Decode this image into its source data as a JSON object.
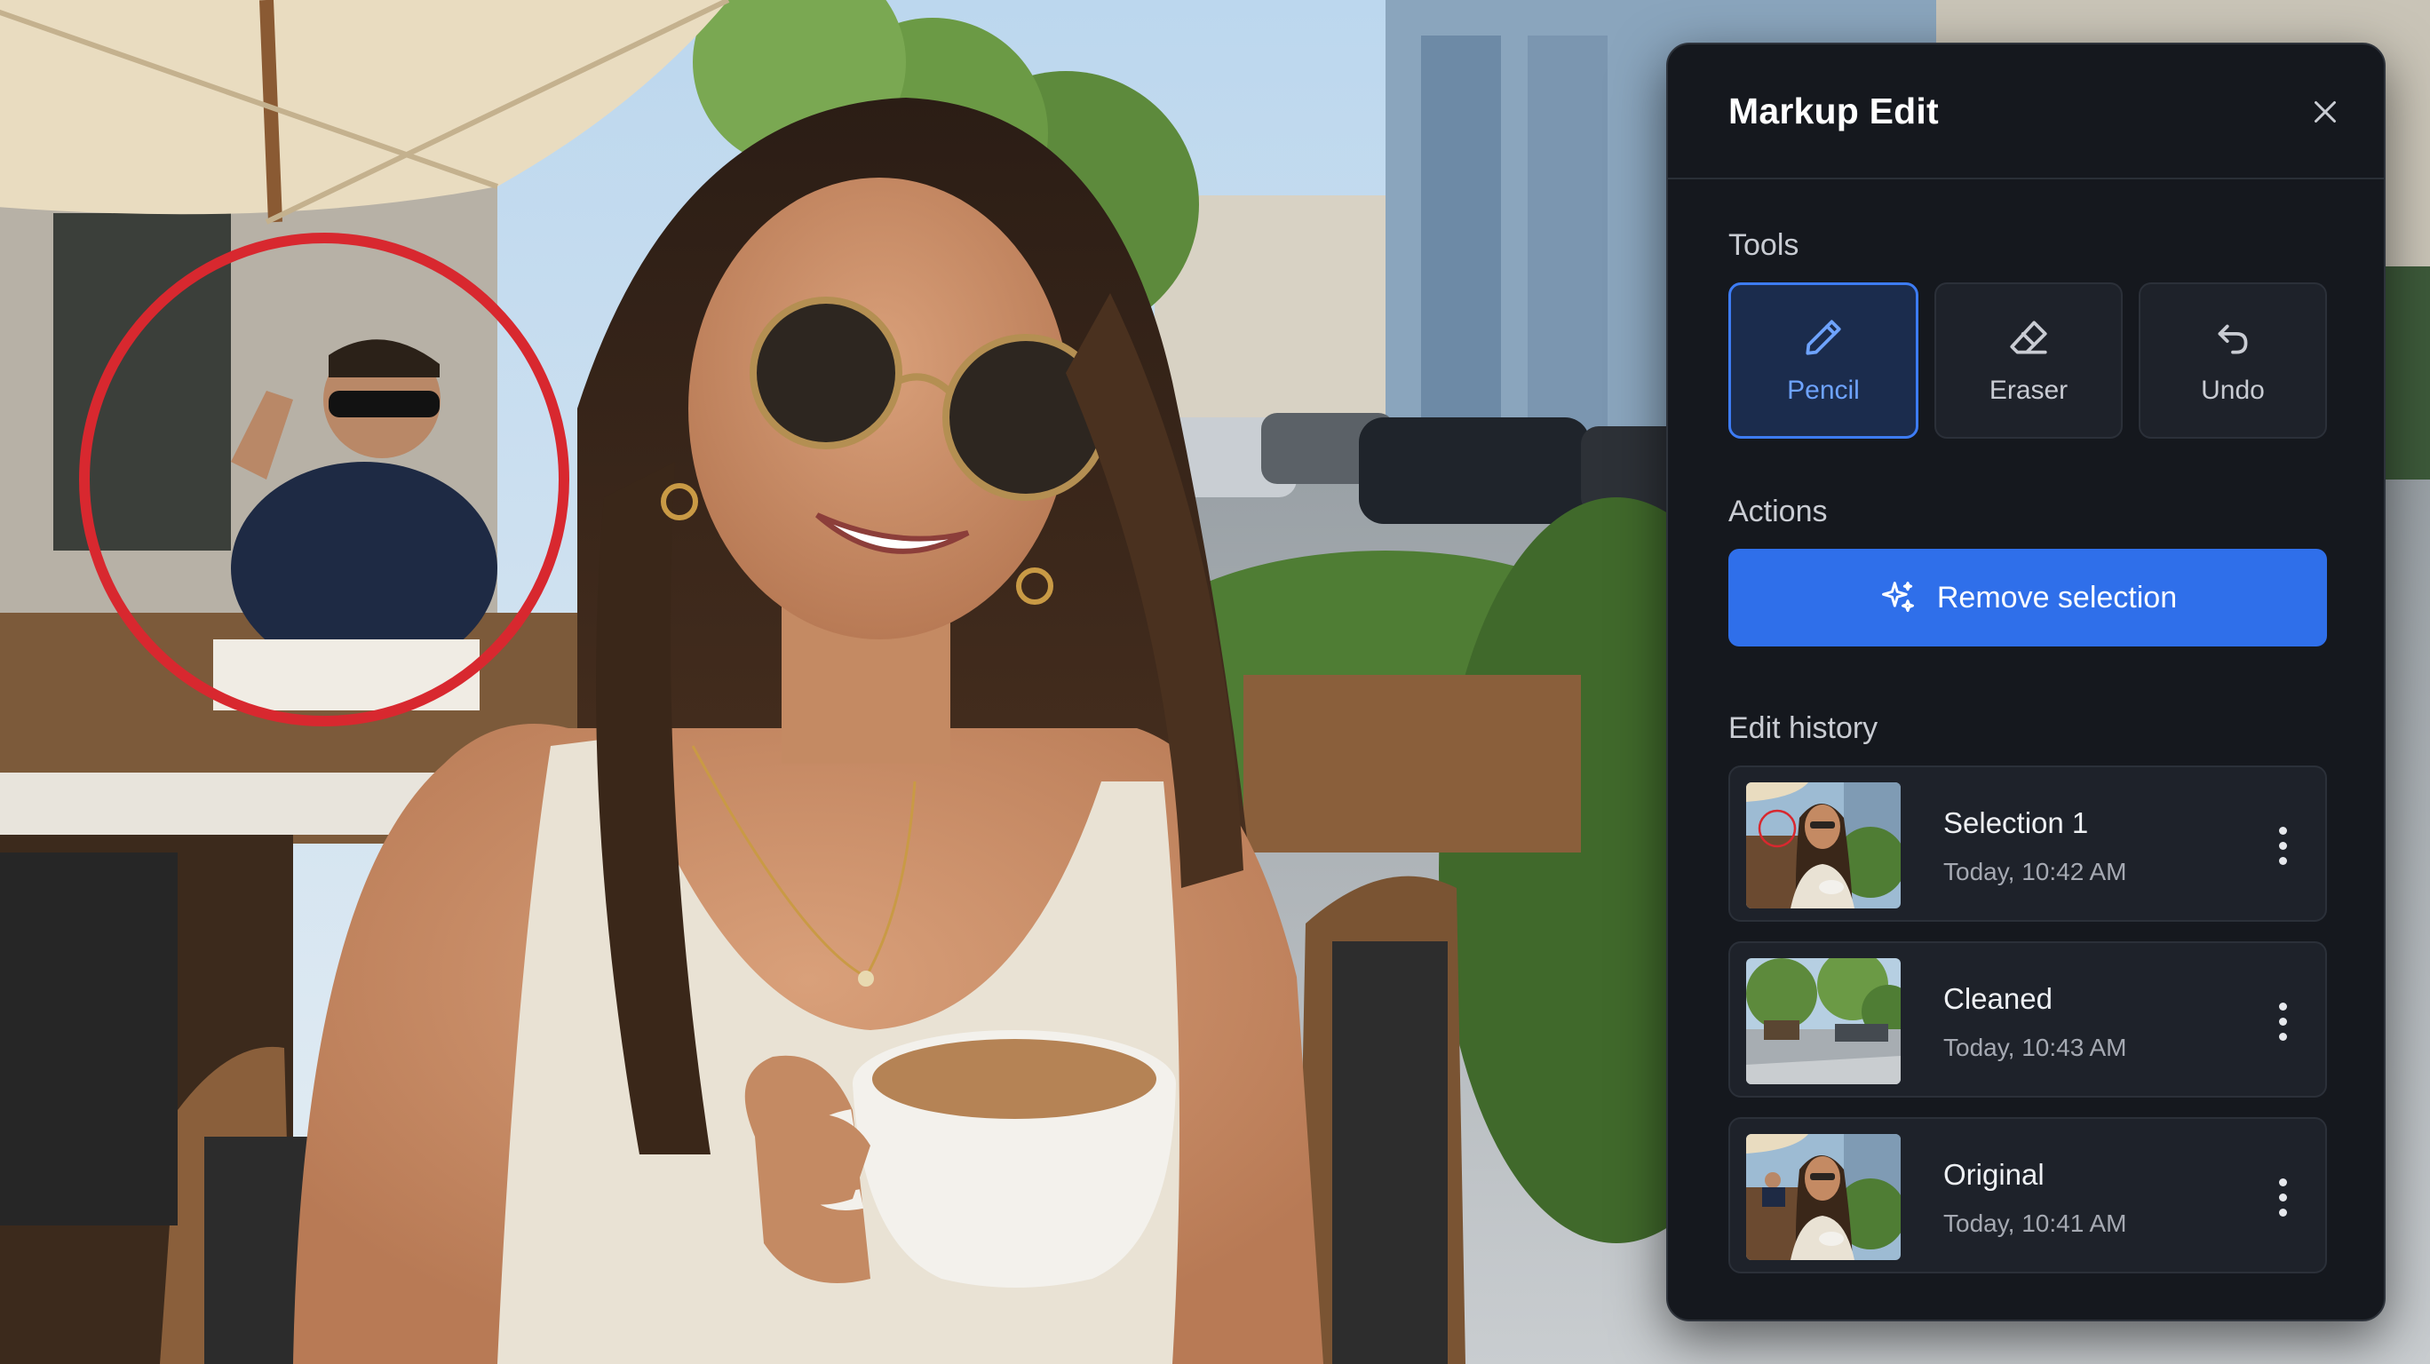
{
  "panel": {
    "title": "Markup Edit",
    "sections": {
      "tools": "Tools",
      "actions": "Actions",
      "history": "Edit history"
    },
    "tools": [
      {
        "label": "Pencil",
        "icon": "pencil-icon",
        "active": true
      },
      {
        "label": "Eraser",
        "icon": "eraser-icon",
        "active": false
      },
      {
        "label": "Undo",
        "icon": "undo-icon",
        "active": false
      }
    ],
    "primary_action": {
      "label": "Remove selection",
      "icon": "sparkles-icon"
    },
    "history": [
      {
        "name": "Selection 1",
        "time": "Today, 10:42 AM"
      },
      {
        "name": "Cleaned",
        "time": "Today, 10:43 AM"
      },
      {
        "name": "Original",
        "time": "Today, 10:41 AM"
      }
    ]
  },
  "colors": {
    "accent": "#2f6fea",
    "active_tool": "#6ea3ff",
    "panel_bg": "#15181e",
    "markup_circle": "#d8282f"
  }
}
